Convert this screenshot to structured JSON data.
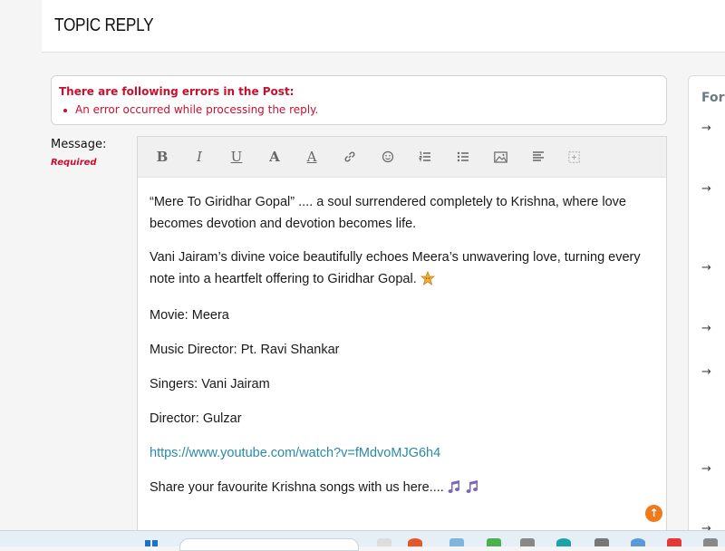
{
  "header": {
    "title": "TOPIC REPLY"
  },
  "errors": {
    "title": "There are following errors in the Post:",
    "items": [
      "An error occurred while processing the reply."
    ]
  },
  "message": {
    "label": "Message:",
    "required": "Required"
  },
  "toolbar": {
    "bold": "B",
    "italic": "I",
    "underline": "U",
    "font": "A",
    "color": "A",
    "icons": [
      "link-icon",
      "emoji-icon",
      "numbered-list-icon",
      "bullet-list-icon",
      "image-icon",
      "align-icon",
      "expand-icon"
    ]
  },
  "post": {
    "p1": "“Mere To Giridhar Gopal” .... a soul surrendered completely to Krishna, where love becomes devotion and devotion becomes life.",
    "p2": "Vani Jairam’s divine voice beautifully echoes Meera’s unwavering love, turning every note into a heartfelt offering to Giridhar Gopal.",
    "movie": "Movie: Meera",
    "music": "Music Director: Pt. Ravi Shankar",
    "singers": "Singers: Vani Jairam",
    "director": "Director: Gulzar",
    "link": "https://www.youtube.com/watch?v=fMdvoMJG6h4",
    "closing": "Share your favourite Krishna songs with us here...."
  },
  "sidebar": {
    "title": "Foru"
  },
  "colors": {
    "error": "#c8102e",
    "link": "#2a8aa6",
    "scroll_top": "#ee7a1c"
  }
}
